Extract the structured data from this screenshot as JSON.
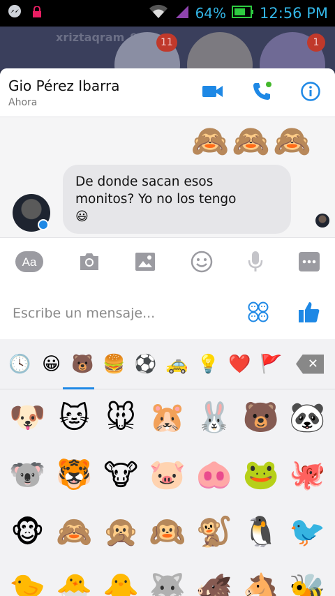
{
  "status_bar": {
    "battery": "64%",
    "time": "12:56 PM"
  },
  "background": {
    "name": "xriztaqram_93",
    "badges": [
      "11",
      "1"
    ]
  },
  "chat": {
    "contact_name": "Gio Pérez Ibarra",
    "contact_status": "Ahora",
    "stickers": [
      "🙈",
      "🙈",
      "🙈"
    ],
    "message": {
      "line1": "De donde sacan esos",
      "line2": "monitos? Yo no los tengo",
      "emoji": "😃"
    }
  },
  "toolbar": {
    "text_label": "Aa"
  },
  "composer": {
    "placeholder": "Escribe un mensaje..."
  },
  "panel": {
    "tabs": [
      "🕓",
      "😀",
      "🐻",
      "🍔",
      "⚽",
      "🚕",
      "💡",
      "❤️",
      "🚩"
    ],
    "grid": [
      "🐶",
      "🐱",
      "🐭",
      "🐹",
      "🐰",
      "🐻",
      "🐼",
      "🐨",
      "🐯",
      "🐮",
      "🐷",
      "🐽",
      "🐸",
      "🐙",
      "🐵",
      "🙈",
      "🙊",
      "🙉",
      "🐒",
      "🐧",
      "🐦",
      "🐤",
      "🐣",
      "🐥",
      "🐺",
      "🐗",
      "🐴",
      "🐝"
    ]
  },
  "colors": {
    "accent": "#1e88e5",
    "badge": "#c0392b",
    "statusbar_text": "#33b5e5"
  }
}
